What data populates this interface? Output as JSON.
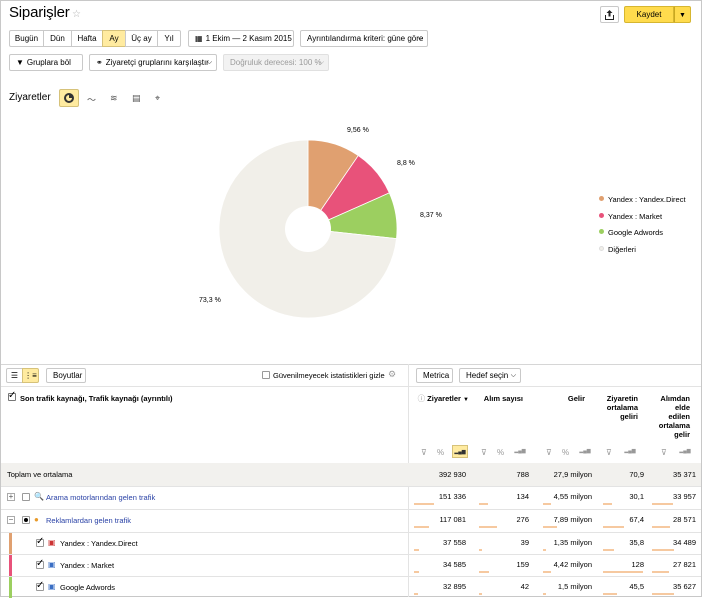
{
  "header": {
    "title": "Siparişler",
    "save_label": "Kaydet"
  },
  "periods": [
    "Bugün",
    "Dün",
    "Hafta",
    "Ay",
    "Üç ay",
    "Yıl"
  ],
  "active_period": "Ay",
  "date_range": "1 Ekim — 2 Kasım 2015",
  "detail_select": "Ayrıntılandırma kriteri: güne göre",
  "group_button": "Gruplara böl",
  "compare_button": "Ziyaretçi gruplarını karşılaştır",
  "accuracy_label": "Doğruluk derecesi: 100 %",
  "chart_section_title": "Ziyaretler",
  "colors": {
    "yandex_direct": "#e0a070",
    "yandex_market": "#e8527a",
    "google_adwords": "#9ccf60",
    "others": "#f1efe9",
    "accent_yellow": "#ffdb4d"
  },
  "chart_data": {
    "type": "pie",
    "labels": [
      "Yandex : Yandex.Direct",
      "Yandex : Market",
      "Google Adwords",
      "Diğerleri"
    ],
    "values": [
      9.56,
      8.8,
      8.37,
      73.3
    ],
    "value_labels": [
      "9,56 %",
      "8,8 %",
      "8,37 %",
      "73,3 %"
    ],
    "legend_position": "right"
  },
  "table_toolbar": {
    "dimensions_button": "Boyutlar",
    "unreliable_label": "Güvenilmeyecek istatistikleri gizle",
    "metrica_button": "Metrica",
    "goal_select": "Hedef seçin"
  },
  "table": {
    "dimension_header": "Son trafik kaynağı, Trafik kaynağı (ayrıntılı)",
    "columns": [
      "Ziyaretler",
      "Alım sayısı",
      "Gelir",
      "Ziyaretin ortalama geliri",
      "Alımdan elde edilen ortalama gelir"
    ],
    "total_label": "Toplam ve ortalama",
    "total": [
      "392 930",
      "788",
      "27,9 milyon",
      "70,9",
      "35 371"
    ],
    "rows": [
      {
        "label": "Arama motorlarından gelen trafik",
        "values": [
          "151 336",
          "134",
          "4,55 milyon",
          "30,1",
          "33 957"
        ]
      },
      {
        "label": "Reklamlardan gelen trafik",
        "values": [
          "117 081",
          "276",
          "7,89 milyon",
          "67,4",
          "28 571"
        ]
      },
      {
        "label": "Yandex : Yandex.Direct",
        "values": [
          "37 558",
          "39",
          "1,35 milyon",
          "35,8",
          "34 489"
        ]
      },
      {
        "label": "Yandex : Market",
        "values": [
          "34 585",
          "159",
          "4,42 milyon",
          "128",
          "27 821"
        ]
      },
      {
        "label": "Google Adwords",
        "values": [
          "32 895",
          "42",
          "1,5 milyon",
          "45,5",
          "35 627"
        ]
      }
    ]
  }
}
